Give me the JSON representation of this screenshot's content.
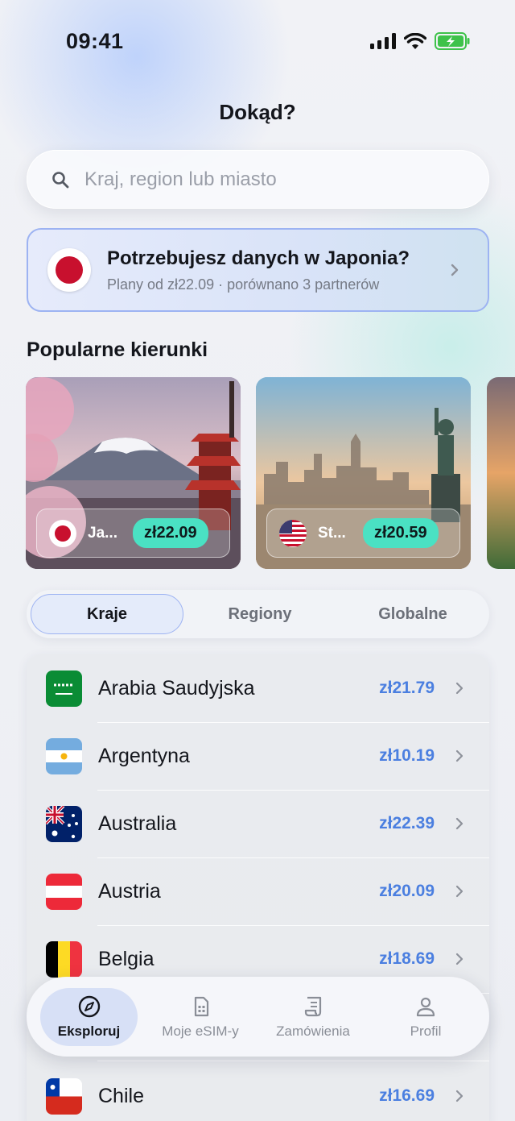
{
  "status_bar": {
    "time": "09:41"
  },
  "header": {
    "title": "Dokąd?"
  },
  "search": {
    "placeholder": "Kraj, region lub miasto"
  },
  "promo": {
    "title": "Potrzebujesz danych w Japonia?",
    "subtitle": "Plany od zł22.09 · porównano 3 partnerów"
  },
  "popular": {
    "title": "Popularne kierunki",
    "cards": [
      {
        "name": "Ja...",
        "price": "zł22.09"
      },
      {
        "name": "St...",
        "price": "zł20.59"
      }
    ]
  },
  "segments": {
    "tabs": [
      "Kraje",
      "Regiony",
      "Globalne"
    ],
    "selected": "Kraje"
  },
  "countries": [
    {
      "name": "Arabia Saudyjska",
      "price": "zł21.79"
    },
    {
      "name": "Argentyna",
      "price": "zł10.19"
    },
    {
      "name": "Australia",
      "price": "zł22.39"
    },
    {
      "name": "Austria",
      "price": "zł20.09"
    },
    {
      "name": "Belgia",
      "price": "zł18.69"
    },
    {
      "name": "Chile",
      "price": "zł16.69"
    }
  ],
  "tabbar": {
    "items": [
      {
        "label": "Eksploruj",
        "icon": "compass-icon"
      },
      {
        "label": "Moje eSIM-y",
        "icon": "sim-card-icon"
      },
      {
        "label": "Zamówienia",
        "icon": "receipt-icon"
      },
      {
        "label": "Profil",
        "icon": "person-icon"
      }
    ]
  },
  "colors": {
    "accent": "#4b7fe0",
    "price_pill": "#4ae1c3",
    "promo_border": "#9db3f2"
  }
}
